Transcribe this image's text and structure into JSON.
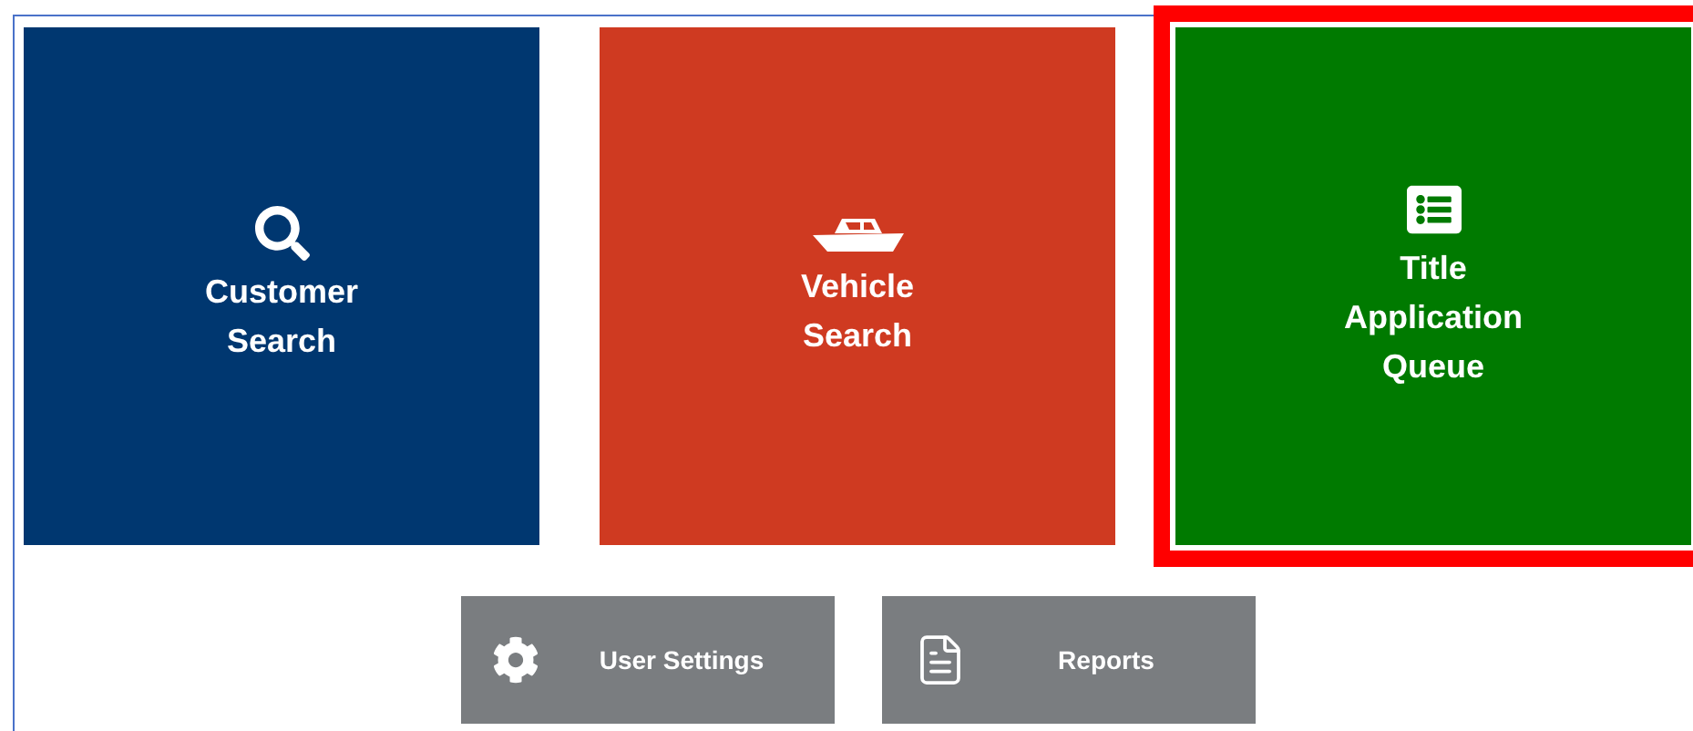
{
  "tiles": [
    {
      "label": "Customer Search",
      "kind": "search",
      "color": "#003770",
      "selected": false
    },
    {
      "label": "Vehicle Search",
      "kind": "boat",
      "color": "#cf3a21",
      "selected": false
    },
    {
      "label": "Title Application Queue",
      "kind": "list",
      "color": "#007a00",
      "selected": true
    }
  ],
  "buttons": [
    {
      "label": "User Settings",
      "kind": "settings"
    },
    {
      "label": "Reports",
      "kind": "report"
    }
  ]
}
